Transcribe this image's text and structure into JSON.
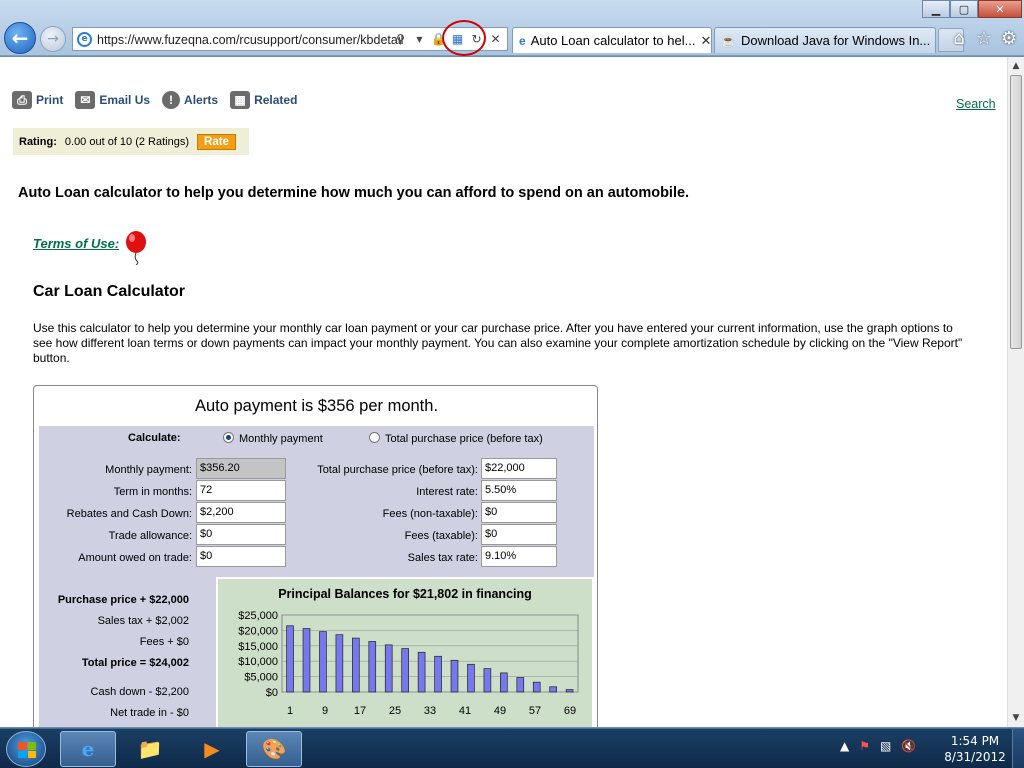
{
  "browser": {
    "url": "https://www.fuzeqna.com/rcusupport/consumer/kbdetail",
    "tabs": [
      {
        "label": "Auto Loan calculator to hel...",
        "active": true
      },
      {
        "label": "Download Java for Windows In...",
        "active": false
      }
    ],
    "window_buttons": {
      "minimize": "▁",
      "maximize": "▢",
      "close": "✕"
    }
  },
  "toolbar": {
    "print": "Print",
    "email": "Email Us",
    "alerts": "Alerts",
    "related": "Related",
    "search": "Search"
  },
  "rating": {
    "label": "Rating:",
    "value": "0.00 out of 10 (2 Ratings)",
    "button": "Rate"
  },
  "article": {
    "headline": "Auto Loan calculator to help you determine how much you can afford to spend on an automobile.",
    "terms": "Terms of Use:",
    "calc_title": "Car Loan Calculator",
    "intro": "Use this calculator to help you determine your monthly car loan payment or your car purchase price. After you have entered your current information, use the graph options to see how different loan terms or down payments can impact your monthly payment. You can also examine your complete amortization schedule by clicking on the \"View Report\" button."
  },
  "calculator": {
    "result": "Auto payment is $356 per month.",
    "calculate_label": "Calculate:",
    "option_monthly": "Monthly payment",
    "option_total": "Total purchase price (before tax)",
    "left_fields": [
      {
        "label": "Monthly payment:",
        "value": "$356.20"
      },
      {
        "label": "Term in months:",
        "value": "72"
      },
      {
        "label": "Rebates and Cash Down:",
        "value": "$2,200"
      },
      {
        "label": "Trade allowance:",
        "value": "$0"
      },
      {
        "label": "Amount owed on trade:",
        "value": "$0"
      }
    ],
    "right_fields": [
      {
        "label": "Total purchase price (before tax):",
        "value": "$22,000"
      },
      {
        "label": "Interest rate:",
        "value": "5.50%"
      },
      {
        "label": "Fees (non-taxable):",
        "value": "$0"
      },
      {
        "label": "Fees (taxable):",
        "value": "$0"
      },
      {
        "label": "Sales tax rate:",
        "value": "9.10%"
      }
    ],
    "summary": {
      "purchase": "Purchase price + $22,000",
      "sales_tax": "Sales tax + $2,002",
      "fees": "Fees + $0",
      "total": "Total price = $24,002",
      "cash_down": "Cash down - $2,200",
      "net_trade": "Net trade in - $0"
    }
  },
  "chart_data": {
    "type": "bar",
    "title": "Principal Balances for $21,802  in financing",
    "xlabel": "",
    "ylabel": "",
    "x_ticks": [
      "1",
      "9",
      "17",
      "25",
      "33",
      "41",
      "49",
      "57",
      "69"
    ],
    "y_ticks": [
      "$25,000",
      "$20,000",
      "$15,000",
      "$10,000",
      "$5,000",
      "$0"
    ],
    "ylim": [
      0,
      25000
    ],
    "grid": true,
    "bar_color": "#7777ee",
    "values": [
      21500,
      20600,
      19600,
      18600,
      17500,
      16400,
      15300,
      14100,
      12900,
      11600,
      10300,
      9000,
      7600,
      6200,
      4700,
      3200,
      1700,
      800
    ]
  },
  "taskbar": {
    "time": "1:54 PM",
    "date": "8/31/2012"
  }
}
